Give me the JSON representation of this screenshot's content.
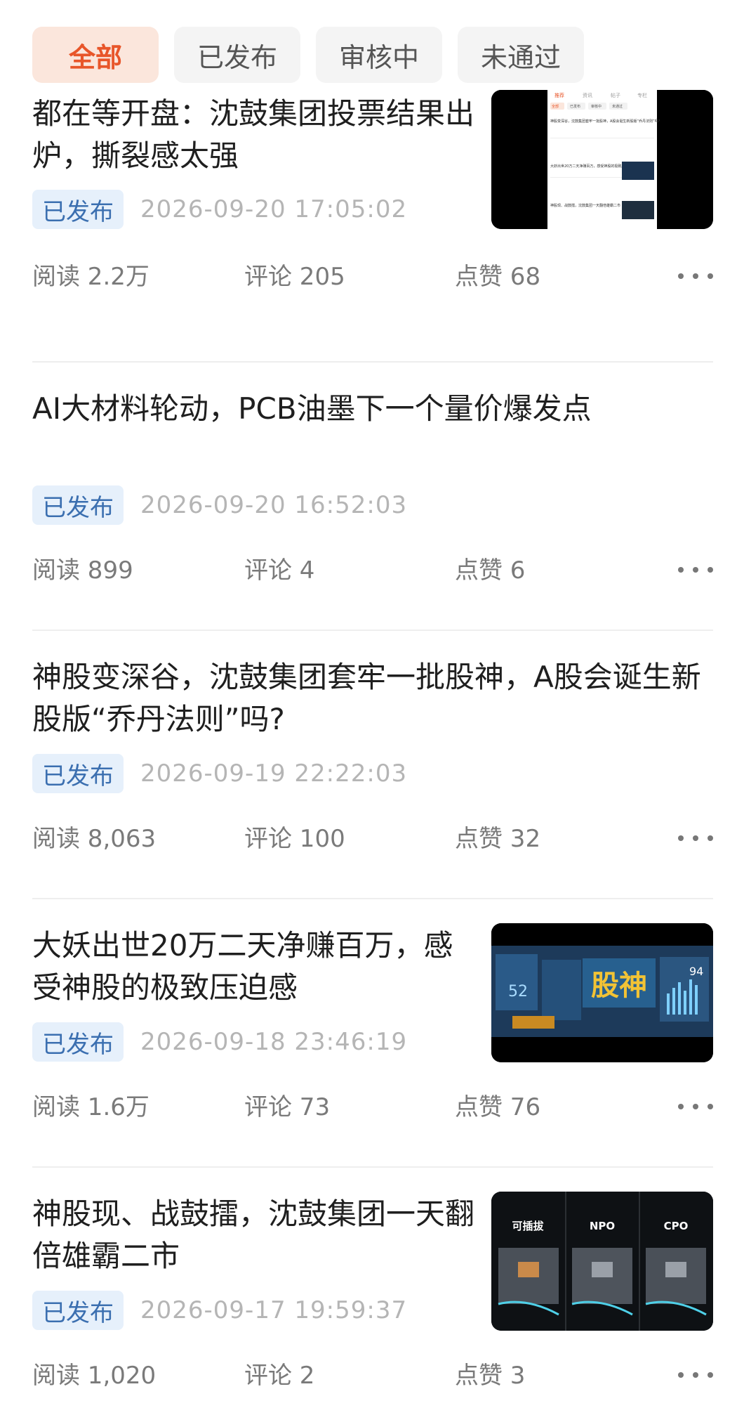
{
  "tabs": [
    {
      "label": "全部",
      "active": true
    },
    {
      "label": "已发布",
      "active": false
    },
    {
      "label": "审核中",
      "active": false
    },
    {
      "label": "未通过",
      "active": false
    }
  ],
  "articles": [
    {
      "title": "都在等开盘：沈鼓集团投票结果出炉，撕裂感太强",
      "status": "已发布",
      "date": "2026-09-20 17:05:02",
      "read": "阅读 2.2万",
      "comment": "评论 205",
      "like": "点赞 68",
      "thumb_texts": {
        "tabs": [
          "推荐",
          "资讯",
          "帖子",
          "专栏"
        ],
        "chips": [
          "全部",
          "已发布",
          "审核中",
          "未通过"
        ],
        "lines": [
          "神股变深谷，沈鼓集团套牢一批股神，A股会诞生新股版“乔丹法则”吗?",
          "大妖出世20万二天净赚百万，感受神股的极致压迫感",
          "神股现、战鼓擂，沈鼓集团一天翻倍雄霸二市"
        ]
      }
    },
    {
      "title": "AI大材料轮动，PCB油墨下一个量价爆发点",
      "status": "已发布",
      "date": "2026-09-20 16:52:03",
      "read": "阅读 899",
      "comment": "评论 4",
      "like": "点赞 6"
    },
    {
      "title": "神股变深谷，沈鼓集团套牢一批股神，A股会诞生新股版“乔丹法则”吗?",
      "status": "已发布",
      "date": "2026-09-19 22:22:03",
      "read": "阅读 8,063",
      "comment": "评论 100",
      "like": "点赞 32"
    },
    {
      "title": "大妖出世20万二天净赚百万，感受神股的极致压迫感",
      "status": "已发布",
      "date": "2026-09-18 23:46:19",
      "read": "阅读 1.6万",
      "comment": "评论 73",
      "like": "点赞 76",
      "thumb_texts": {
        "big": "股神",
        "n1": "52",
        "n2": "94"
      }
    },
    {
      "title": "神股现、战鼓擂，沈鼓集团一天翻倍雄霸二市",
      "status": "已发布",
      "date": "2026-09-17 19:59:37",
      "read": "阅读 1,020",
      "comment": "评论 2",
      "like": "点赞 3",
      "thumb_texts": {
        "labels": [
          "可插拔",
          "NPO",
          "CPO"
        ]
      }
    }
  ],
  "colors": {
    "accent": "#e8562a",
    "accent_bg": "#fbe6dc",
    "badge_text": "#3b6fb0",
    "badge_bg": "#e6f0fb",
    "date": "#b5b5b5",
    "stat": "#7a7a7a"
  },
  "icons": {
    "more": "more-dots-icon"
  }
}
